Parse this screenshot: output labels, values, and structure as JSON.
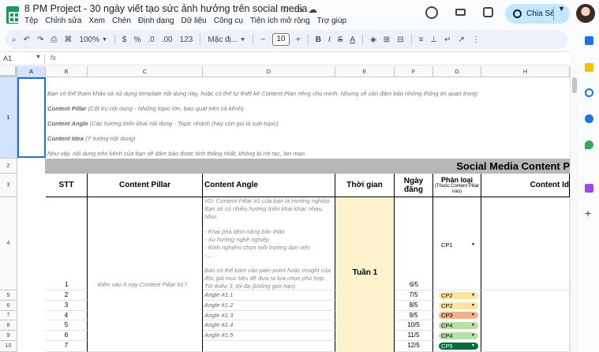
{
  "title_bar": {
    "doc_title": "8 PM Project - 30 ngày viết tạo sức ảnh hưởng trên social media",
    "share_label": "Chia Sẻ"
  },
  "menu": [
    "Tệp",
    "Chỉnh sửa",
    "Xem",
    "Chèn",
    "Định dạng",
    "Dữ liệu",
    "Công cụ",
    "Tiện ích mở rộng",
    "Trợ giúp"
  ],
  "toolbar": {
    "zoom": "100%",
    "currency": "$",
    "percent": "%",
    "dec_less": ".0",
    "dec_more": ".00",
    "num_format": "123",
    "font": "Mặc đị...",
    "font_size": "10",
    "bold": "B",
    "italic": "I",
    "strike": "S",
    "text_color": "A"
  },
  "formula_bar": {
    "cell_ref": "A1",
    "fx": "fx"
  },
  "columns": [
    "A",
    "B",
    "C",
    "D",
    "E",
    "F",
    "G",
    "H"
  ],
  "rows": [
    "1",
    "2",
    "3",
    "4",
    "5",
    "6",
    "7",
    "8",
    "9",
    "10"
  ],
  "intro": {
    "line1": "Bạn có thể tham khảo và sử dụng template nội dung này, hoặc có thể tự thiết kế Content Plan riêng cho mình. Nhưng sẽ cần đảm bảo những thông tin quan trọng:",
    "line2_bold": "Content Pillar",
    "line2_rest": " (Cột trụ nội dung - Những topic lớn, bao quát trên cả kênh)",
    "line3_bold": "Content Angle",
    "line3_rest": " (Các hướng triển khai nội dung - Topic nhánh (hay còn gọi là sub-topic)",
    "line4_bold": "Content Idea",
    "line4_rest": " (Ý tưởng nội dung)",
    "line5": "Như vậy, nội dung trên kênh của bạn sẽ đảm bảo được tính thống nhất, không bị rời rạc, lan man."
  },
  "banner_title": "Social Media Content P",
  "headers": {
    "stt": "STT",
    "pillar": "Content Pillar",
    "angle": "Content Angle",
    "time": "Thời gian",
    "date": "Ngày đăng",
    "type_main": "Phân loại",
    "type_sub": "(Thuộc Content Pillar nào)",
    "idea": "Content Id"
  },
  "pillar_placeholder": "Điền vào ô này Content Pillar #1?",
  "angle_description": "VD: Content Pillar #1 của bạn là Hướng nghiệp. Bạn sẽ có nhiều hướng triển khai khác nhau. Như:\n\n- Khai phá tiềm năng bản thân\n- Xu hướng nghề nghiệp\n- Kinh nghiệm chọn môi trường làm việc\n-...\n\nBạn có thể bám vào pain-point hoặc insight của độc giả mục tiêu để đưa ra lựa chọn phù hợp. Tối thiểu 3, tối đa (không giới hạn)",
  "week_label": "Tuần 1",
  "data_rows": [
    {
      "stt": "1",
      "angle": "",
      "date": "6/5",
      "cp": "CP1",
      "color": "white"
    },
    {
      "stt": "2",
      "angle": "Angle #1.1",
      "date": "7/5",
      "cp": "CP2",
      "color": "yellow"
    },
    {
      "stt": "3",
      "angle": "Angle #1.2",
      "date": "8/5",
      "cp": "CP2",
      "color": "yellow"
    },
    {
      "stt": "4",
      "angle": "Angle #1.3",
      "date": "9/5",
      "cp": "CP3",
      "color": "red"
    },
    {
      "stt": "5",
      "angle": "Angle #1.4",
      "date": "10/5",
      "cp": "CP4",
      "color": "green"
    },
    {
      "stt": "6",
      "angle": "Angle #1.5",
      "date": "11/5",
      "cp": "CP4",
      "color": "green"
    },
    {
      "stt": "7",
      "angle": "",
      "date": "12/5",
      "cp": "CP5",
      "color": "dgreen"
    }
  ]
}
